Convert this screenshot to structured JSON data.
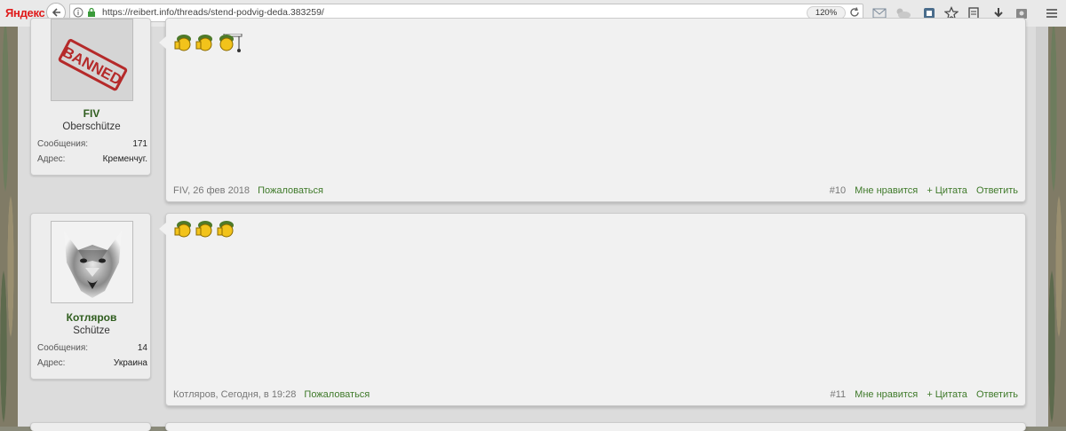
{
  "browser": {
    "brand": "Яндекс",
    "url": "https://reibert.info/threads/stend-podvig-deda.383259/",
    "zoom": "120%"
  },
  "posts": [
    {
      "username": "FIV",
      "user_title": "Oberschütze",
      "avatar_stamp": "BANNED",
      "stats": [
        {
          "label": "Сообщения:",
          "value": "171"
        },
        {
          "label": "Адрес:",
          "value": "Кременчуг."
        }
      ],
      "meta_author": "FIV, 26 фев 2018",
      "report_label": "Пожаловаться",
      "post_number": "#10",
      "like_label": "Мне нравится",
      "quote_label": "+ Цитата",
      "reply_label": "Ответить"
    },
    {
      "username": "Котляров",
      "user_title": "Schütze",
      "avatar_icon": "wolf-avatar",
      "stats": [
        {
          "label": "Сообщения:",
          "value": "14"
        },
        {
          "label": "Адрес:",
          "value": "Украина"
        }
      ],
      "meta_author": "Котляров, Сегодня, в 19:28",
      "report_label": "Пожаловаться",
      "post_number": "#11",
      "like_label": "Мне нравится",
      "quote_label": "+ Цитата",
      "reply_label": "Ответить"
    }
  ]
}
